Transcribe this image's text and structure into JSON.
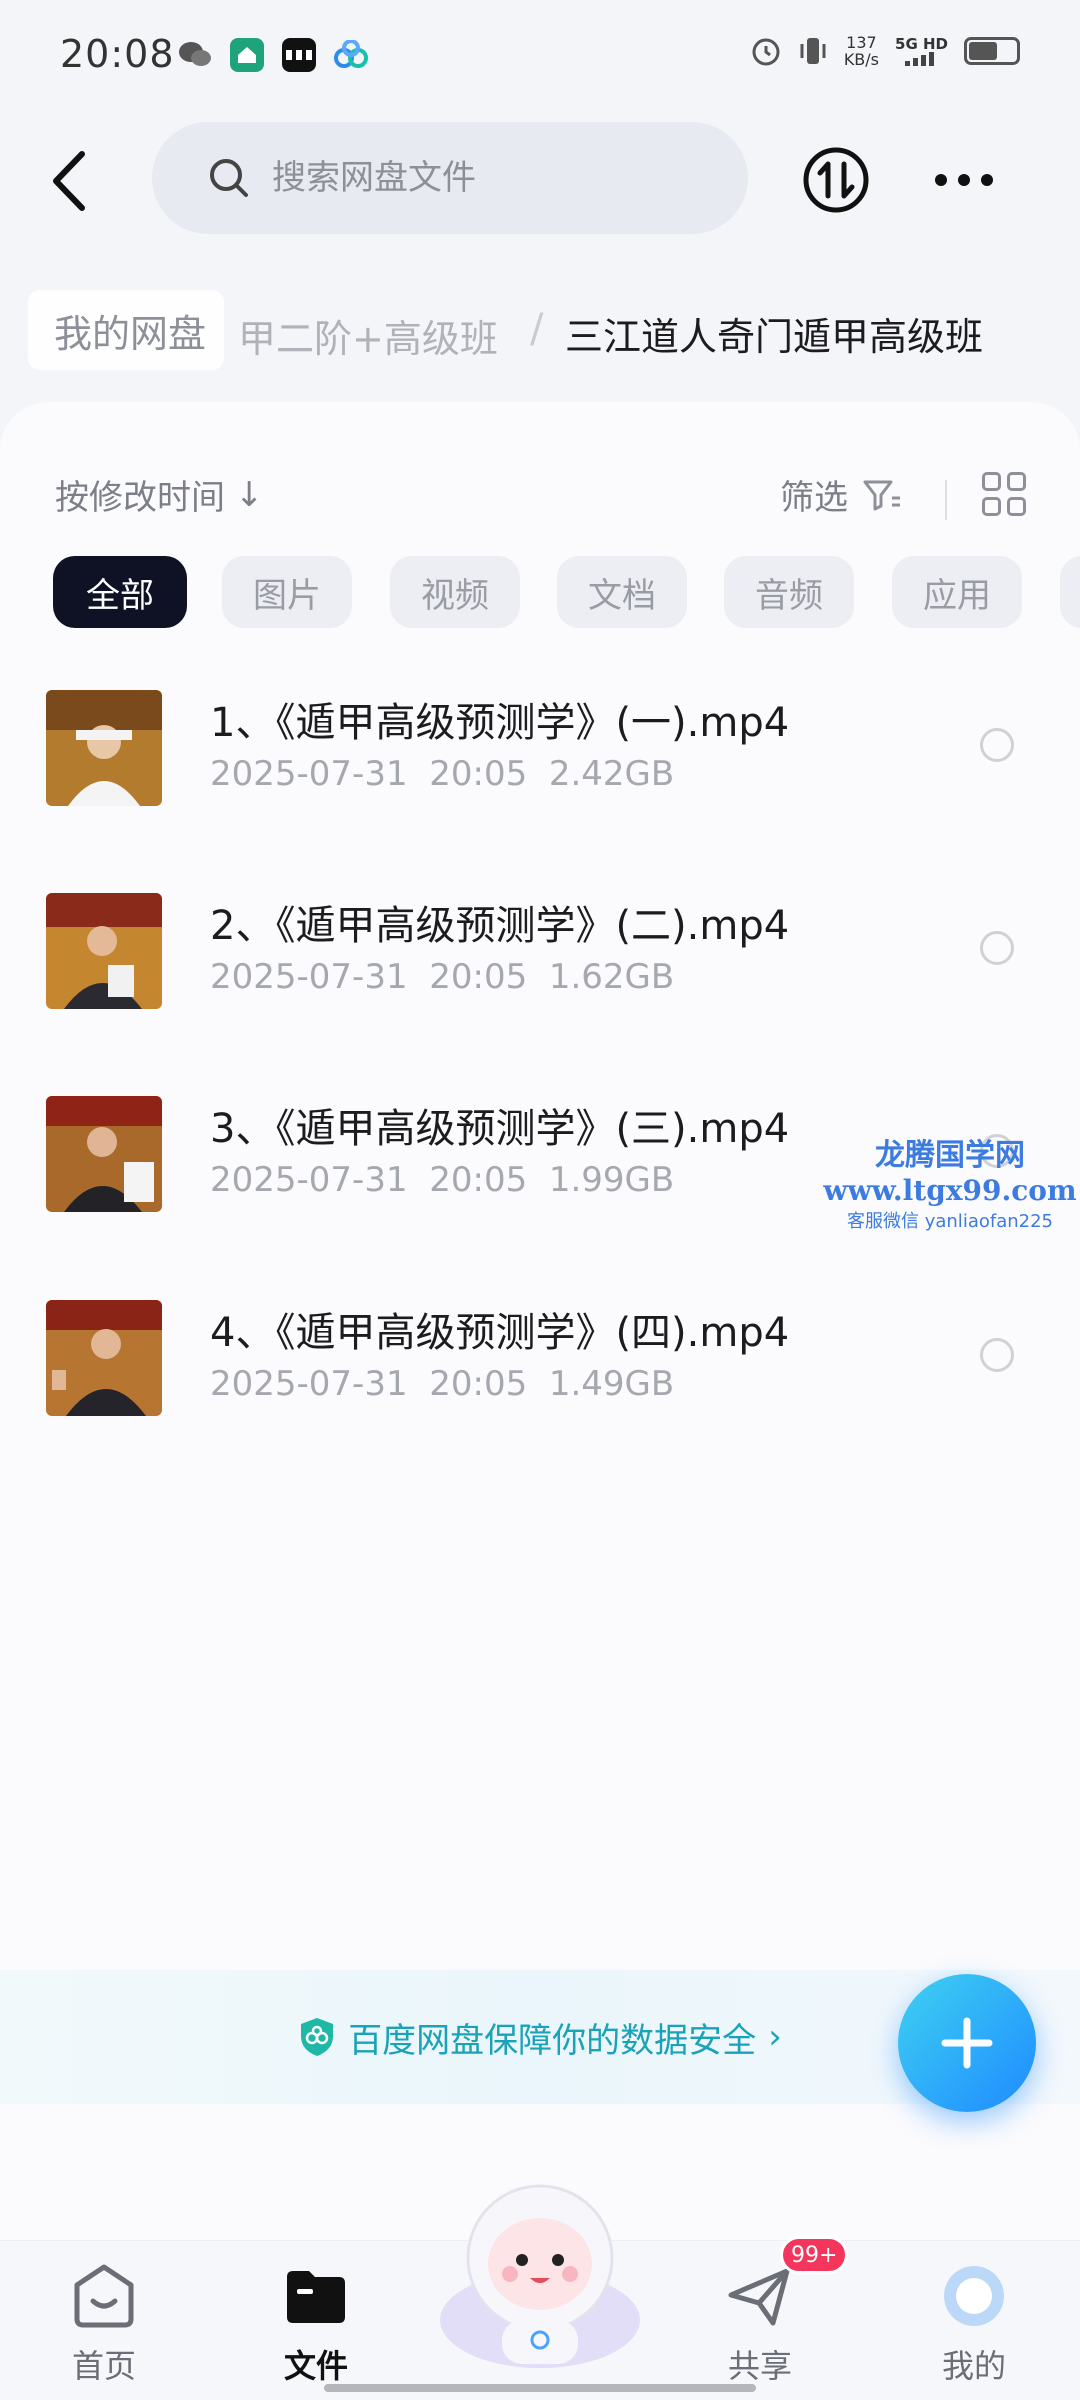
{
  "status_bar": {
    "time": "20:08",
    "speed_value": "137",
    "speed_unit": "KB/s",
    "network": "5G HD"
  },
  "search": {
    "placeholder": "搜索网盘文件"
  },
  "breadcrumb": {
    "root": "我的网盘",
    "middle": "甲二阶+高级班",
    "separator": "/",
    "current": "三江道人奇门遁甲高级班"
  },
  "toolbar": {
    "sort_label": "按修改时间",
    "sort_arrow": "↓",
    "filter_label": "筛选"
  },
  "categories": [
    "全部",
    "图片",
    "视频",
    "文档",
    "音频",
    "应用"
  ],
  "files": [
    {
      "name": "1、《遁甲高级预测学》(一).mp4",
      "date": "2025-07-31",
      "time": "20:05",
      "size": "2.42GB"
    },
    {
      "name": "2、《遁甲高级预测学》(二).mp4",
      "date": "2025-07-31",
      "time": "20:05",
      "size": "1.62GB"
    },
    {
      "name": "3、《遁甲高级预测学》(三).mp4",
      "date": "2025-07-31",
      "time": "20:05",
      "size": "1.99GB"
    },
    {
      "name": "4、《遁甲高级预测学》(四).mp4",
      "date": "2025-07-31",
      "time": "20:05",
      "size": "1.49GB"
    }
  ],
  "watermark": {
    "line1": "龙腾国学网",
    "line2": "www.ltgx99.com",
    "line3": "客服微信 yanliaofan225"
  },
  "security_banner": {
    "text": "百度网盘保障你的数据安全",
    "chevron": "›"
  },
  "tabs": [
    {
      "label": "首页",
      "icon": "home-face-icon",
      "active": false
    },
    {
      "label": "文件",
      "icon": "folder-icon",
      "active": true
    },
    {
      "label": "共享",
      "icon": "paper-plane-icon",
      "active": false,
      "badge": "99+"
    },
    {
      "label": "我的",
      "icon": "profile-icon",
      "active": false
    }
  ],
  "colors": {
    "accent": "#1e8bff",
    "active_chip": "#0e1224",
    "badge": "#f5365c",
    "security_text": "#1aa3b8",
    "watermark": "#3c7be0"
  },
  "icons": {
    "back": "chevron-left-icon",
    "search": "search-icon",
    "transfer": "transfer-icon",
    "more": "more-dots-icon",
    "filter": "filter-icon",
    "grid": "grid-view-icon",
    "security": "shield-icon",
    "fab": "plus-icon"
  }
}
